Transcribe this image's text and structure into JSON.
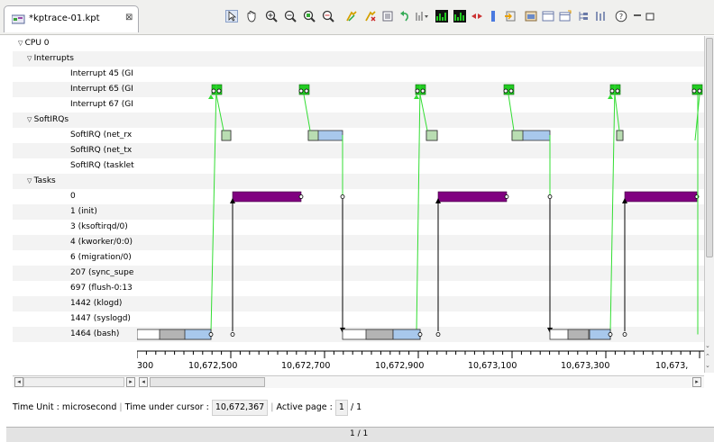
{
  "tab": {
    "title": "*kptrace-01.kpt",
    "close": "⊠"
  },
  "toolbar_icons": [
    "select-icon",
    "hand-icon",
    "zoom-in-icon",
    "zoom-out-icon",
    "zoom-fit-icon",
    "zoom-range-icon",
    "filter-icon",
    "filter-clear-icon",
    "list-icon",
    "undo-icon",
    "markers-icon",
    "bar-chart-icon",
    "bar-chart-alt-icon",
    "arrows-icon",
    "cursor-bar-icon",
    "export-icon",
    "settings-icon",
    "window-icon",
    "layout-icon",
    "tree-icon",
    "columns-icon",
    "help-icon",
    "minimize-icon"
  ],
  "tree": [
    {
      "label": "CPU 0",
      "level": 0,
      "expanded": true
    },
    {
      "label": "Interrupts",
      "level": 1,
      "expanded": true
    },
    {
      "label": "Interrupt 45 (GI",
      "level": 2
    },
    {
      "label": "Interrupt 65 (GI",
      "level": 2
    },
    {
      "label": "Interrupt 67 (GI",
      "level": 2
    },
    {
      "label": "SoftIRQs",
      "level": 1,
      "expanded": true
    },
    {
      "label": "SoftIRQ (net_rx",
      "level": 2
    },
    {
      "label": "SoftIRQ (net_tx",
      "level": 2
    },
    {
      "label": "SoftIRQ (tasklet",
      "level": 2
    },
    {
      "label": "Tasks",
      "level": 1,
      "expanded": true
    },
    {
      "label": "0",
      "level": 2
    },
    {
      "label": "1 (init)",
      "level": 2
    },
    {
      "label": "3 (ksoftirqd/0)",
      "level": 2
    },
    {
      "label": "4 (kworker/0:0)",
      "level": 2
    },
    {
      "label": "6 (migration/0)",
      "level": 2
    },
    {
      "label": "207 (sync_supe",
      "level": 2
    },
    {
      "label": "697 (flush-0:13",
      "level": 2
    },
    {
      "label": "1442 (klogd)",
      "level": 2
    },
    {
      "label": "1447 (syslogd)",
      "level": 2
    },
    {
      "label": "1464 (bash)",
      "level": 2
    }
  ],
  "axis": {
    "labels": [
      "300",
      "10,672,500",
      "10,672,700",
      "10,672,900",
      "10,673,100",
      "10,673,300",
      "10,673,"
    ]
  },
  "status": {
    "time_unit_label": "Time Unit : microsecond",
    "cursor_label": "Time under cursor :",
    "cursor_value": "10,672,367",
    "active_page_label": "Active page :",
    "active_page_value": "1",
    "active_page_total": "/ 1"
  },
  "page_indicator": "1 / 1",
  "colors": {
    "interrupt": "#22cc22",
    "softirq": "#b9ddb2",
    "softirq_alt": "#a8c8ec",
    "task_running": "#800080",
    "bash_gray": "#b4b4b4",
    "bash_blue": "#a8c8ec",
    "link_green": "#33dd33",
    "link_black": "#000000",
    "row_alt": "#f3f3f3"
  }
}
